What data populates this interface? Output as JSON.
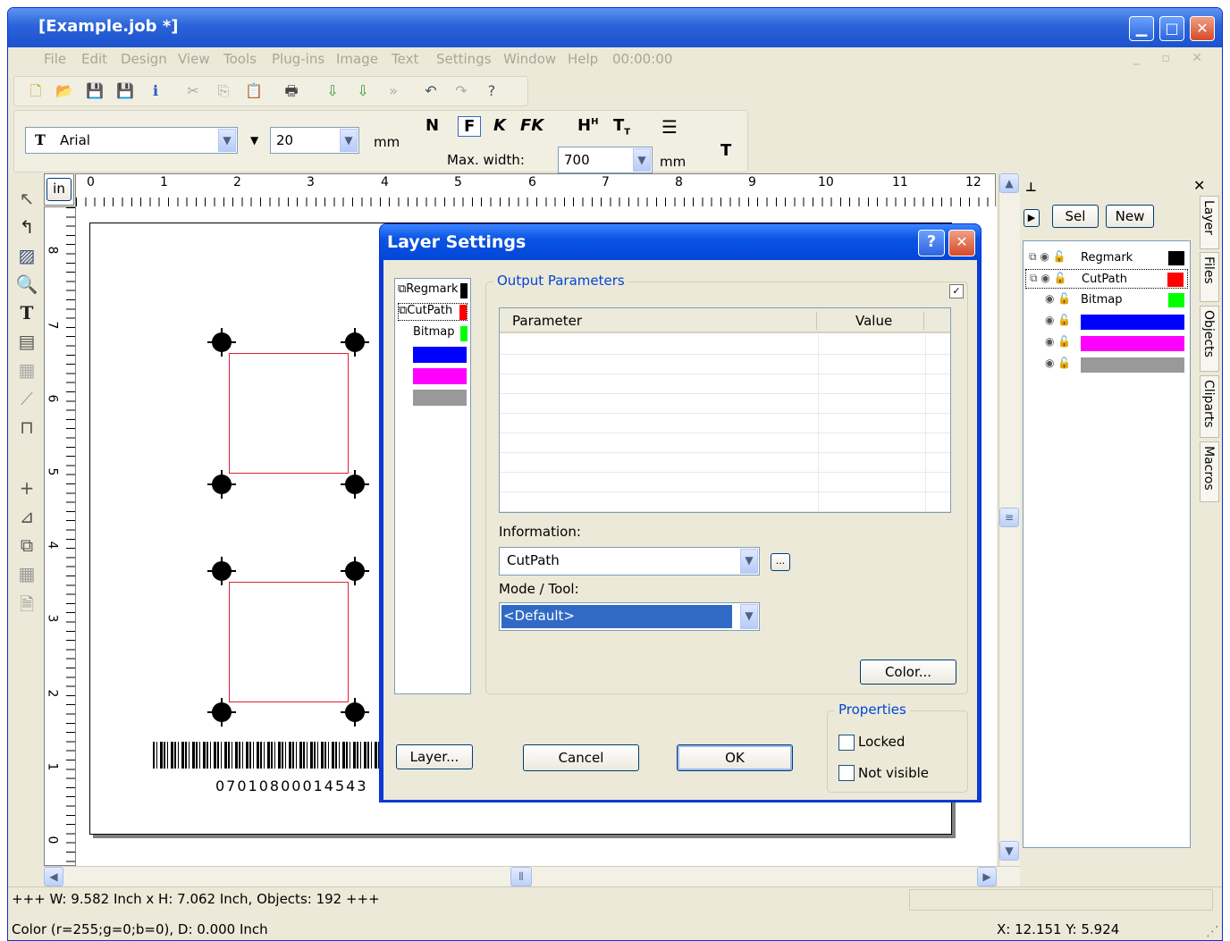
{
  "window": {
    "title": "[Example.job *]"
  },
  "menu": [
    "File",
    "Edit",
    "Design",
    "View",
    "Tools",
    "Plug-ins",
    "Image",
    "Text",
    "Settings",
    "Window",
    "Help",
    "00:00:00"
  ],
  "font_toolbar": {
    "font": "Arial",
    "size": "20",
    "size_unit": "mm",
    "max_width_label": "Max. width:",
    "max_width": "700",
    "max_width_unit": "mm",
    "formats": [
      "N",
      "F",
      "K",
      "FK"
    ],
    "hsup": "H",
    "tsub": "T",
    "text_tool": "T"
  },
  "ruler": {
    "unit": "in",
    "top_labels": [
      "0",
      "1",
      "2",
      "3",
      "4",
      "5",
      "6",
      "7",
      "8",
      "9",
      "10",
      "11",
      "12"
    ],
    "left_labels": [
      "8",
      "7",
      "6",
      "5",
      "4",
      "3",
      "2",
      "1",
      "0"
    ]
  },
  "barcode": {
    "number": "07010800014543"
  },
  "right_panel": {
    "sel": "Sel",
    "new": "New",
    "tabs": [
      "Layer",
      "Files",
      "Objects",
      "Cliparts",
      "Macros"
    ],
    "layers": [
      {
        "name": "Regmark",
        "color": "#000000"
      },
      {
        "name": "CutPath",
        "color": "#ff0000"
      },
      {
        "name": "Bitmap",
        "color": "#00ff00"
      },
      {
        "name": "",
        "color": "#0000ff"
      },
      {
        "name": "",
        "color": "#ff00ff"
      },
      {
        "name": "",
        "color": "#999999"
      }
    ]
  },
  "dialog": {
    "title": "Layer Settings",
    "help": "?",
    "layers": [
      {
        "name": "Regmark",
        "color": "#000000"
      },
      {
        "name": "CutPath",
        "color": "#ff0000"
      },
      {
        "name": "Bitmap",
        "color": "#00ff00"
      },
      {
        "name": "",
        "color": "#0000ff"
      },
      {
        "name": "",
        "color": "#ff00ff"
      },
      {
        "name": "",
        "color": "#999999"
      }
    ],
    "output_params": "Output Parameters",
    "col_param": "Parameter",
    "col_value": "Value",
    "info_label": "Information:",
    "info_value": "CutPath",
    "browse": "...",
    "mode_label": "Mode / Tool:",
    "mode_value": "<Default>",
    "color_btn": "Color...",
    "properties": "Properties",
    "locked": "Locked",
    "not_visible": "Not visible",
    "layer_btn": "Layer...",
    "cancel": "Cancel",
    "ok": "OK"
  },
  "status": {
    "line1": "+++ W: 9.582 Inch x H: 7.062 Inch, Objects: 192 +++",
    "line2": "Color (r=255;g=0;b=0), D: 0.000 Inch",
    "coords": "X: 12.151 Y: 5.924"
  }
}
